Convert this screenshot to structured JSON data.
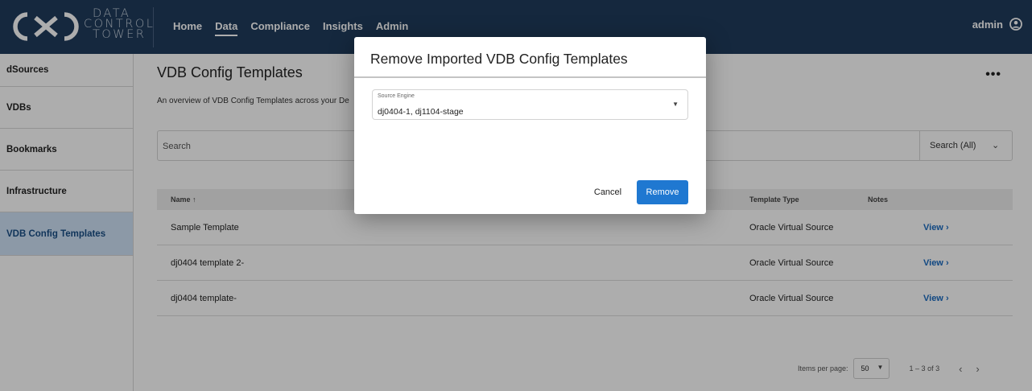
{
  "app": {
    "logo_text": [
      "DATA",
      "CONTROL",
      "TOWER"
    ],
    "nav": [
      {
        "label": "Home"
      },
      {
        "label": "Data"
      },
      {
        "label": "Compliance"
      },
      {
        "label": "Insights"
      },
      {
        "label": "Admin"
      }
    ],
    "active_nav": "Data",
    "user": {
      "name": "admin",
      "icon": "user-circle-icon"
    }
  },
  "sidebar": {
    "items": [
      {
        "label": "dSources"
      },
      {
        "label": "VDBs"
      },
      {
        "label": "Bookmarks"
      },
      {
        "label": "Infrastructure"
      },
      {
        "label": "VDB Config Templates"
      }
    ],
    "active": "VDB Config Templates"
  },
  "main": {
    "title": "VDB Config Templates",
    "subtitle": "An overview of VDB Config Templates across your De",
    "more_icon": "more-horizontal-icon",
    "search": {
      "placeholder": "Search",
      "scope": "Search (All)"
    },
    "table": {
      "columns": {
        "name": "Name",
        "template_type": "Template Type",
        "notes": "Notes"
      },
      "rows": [
        {
          "name": "Sample Template",
          "template_type": "Oracle Virtual Source",
          "action": "View"
        },
        {
          "name": "dj0404 template 2-",
          "template_type": "Oracle Virtual Source",
          "action": "View"
        },
        {
          "name": "dj0404 template-",
          "template_type": "Oracle Virtual Source",
          "action": "View"
        }
      ]
    },
    "pagination": {
      "items_per_page_label": "Items per page:",
      "items_per_page": "50",
      "range": "1 – 3 of 3"
    }
  },
  "modal": {
    "title": "Remove Imported VDB Config Templates",
    "field": {
      "label": "Source Engine",
      "value": "dj0404-1, dj1104-stage"
    },
    "cancel_label": "Cancel",
    "remove_label": "Remove"
  },
  "colors": {
    "topbar": "#1f3b5c",
    "accent": "#1f78d1",
    "sidebar_active_bg": "#cfe2f6"
  }
}
